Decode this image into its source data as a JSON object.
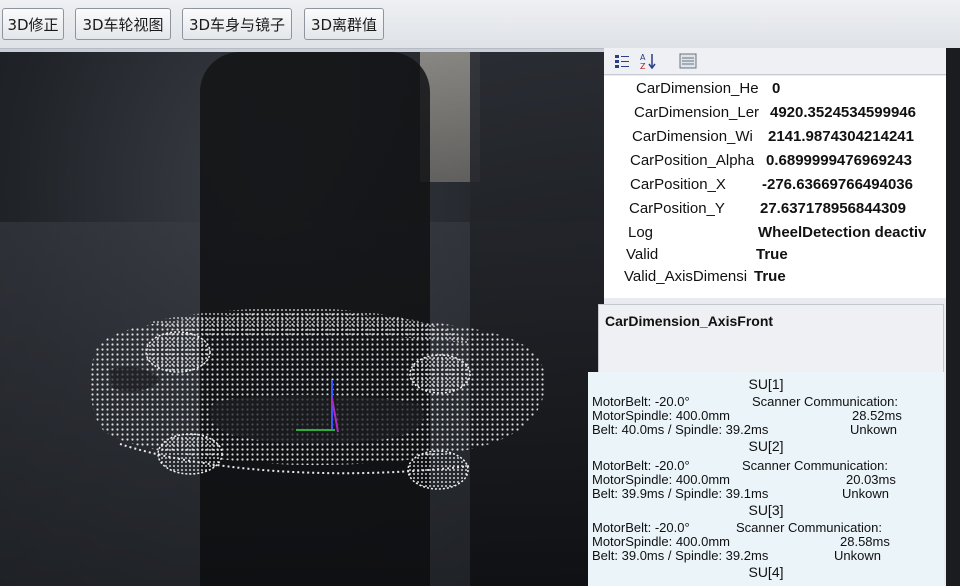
{
  "toolbar": {
    "buttons": [
      "3D修正",
      "3D车轮视图",
      "3D车身与镜子",
      "3D离群值"
    ]
  },
  "icons": {
    "categorized": "categorized-view-icon",
    "alphabetical": "sort-alphabetical-icon",
    "pages": "property-pages-icon"
  },
  "properties": [
    {
      "name": "CarDimension_He",
      "value": "0"
    },
    {
      "name": "CarDimension_Ler",
      "value": "4920.3524534599946"
    },
    {
      "name": "CarDimension_Wi",
      "value": "2141.9874304214241"
    },
    {
      "name": "CarPosition_Alpha",
      "value": "0.6899999476969243"
    },
    {
      "name": "CarPosition_X",
      "value": "-276.63669766494036"
    },
    {
      "name": "CarPosition_Y",
      "value": "27.637178956844309"
    },
    {
      "name": "Log",
      "value": "WheelDetection deactiv"
    },
    {
      "name": "Valid",
      "value": "True"
    },
    {
      "name": "Valid_AxisDimensi",
      "value": "True"
    }
  ],
  "description": {
    "title": "CarDimension_AxisFront"
  },
  "scanners": [
    {
      "title": "SU[1]",
      "motor_belt": "MotorBelt: -20.0°",
      "spindle": "MotorSpindle: 400.0mm",
      "timing": "Belt: 40.0ms / Spindle: 39.2ms",
      "comm_label": "Scanner Communication:",
      "comm_time": "28.52ms",
      "comm_state": "Unkown"
    },
    {
      "title": "SU[2]",
      "motor_belt": "MotorBelt: -20.0°",
      "spindle": "MotorSpindle: 400.0mm",
      "timing": "Belt: 39.9ms / Spindle: 39.1ms",
      "comm_label": "Scanner Communication:",
      "comm_time": "20.03ms",
      "comm_state": "Unkown"
    },
    {
      "title": "SU[3]",
      "motor_belt": "MotorBelt: -20.0°",
      "spindle": "MotorSpindle: 400.0mm",
      "timing": "Belt: 39.0ms / Spindle: 39.2ms",
      "comm_label": "Scanner Communication:",
      "comm_time": "28.58ms",
      "comm_state": "Unkown"
    },
    {
      "title": "SU[4]"
    }
  ],
  "colors": {
    "point_cloud": "#e9e9e9",
    "axis_x": "#2fae3c",
    "axis_y": "#3c56ff",
    "axis_z": "#b02cb8",
    "status_bg": "#eaf4f9"
  }
}
